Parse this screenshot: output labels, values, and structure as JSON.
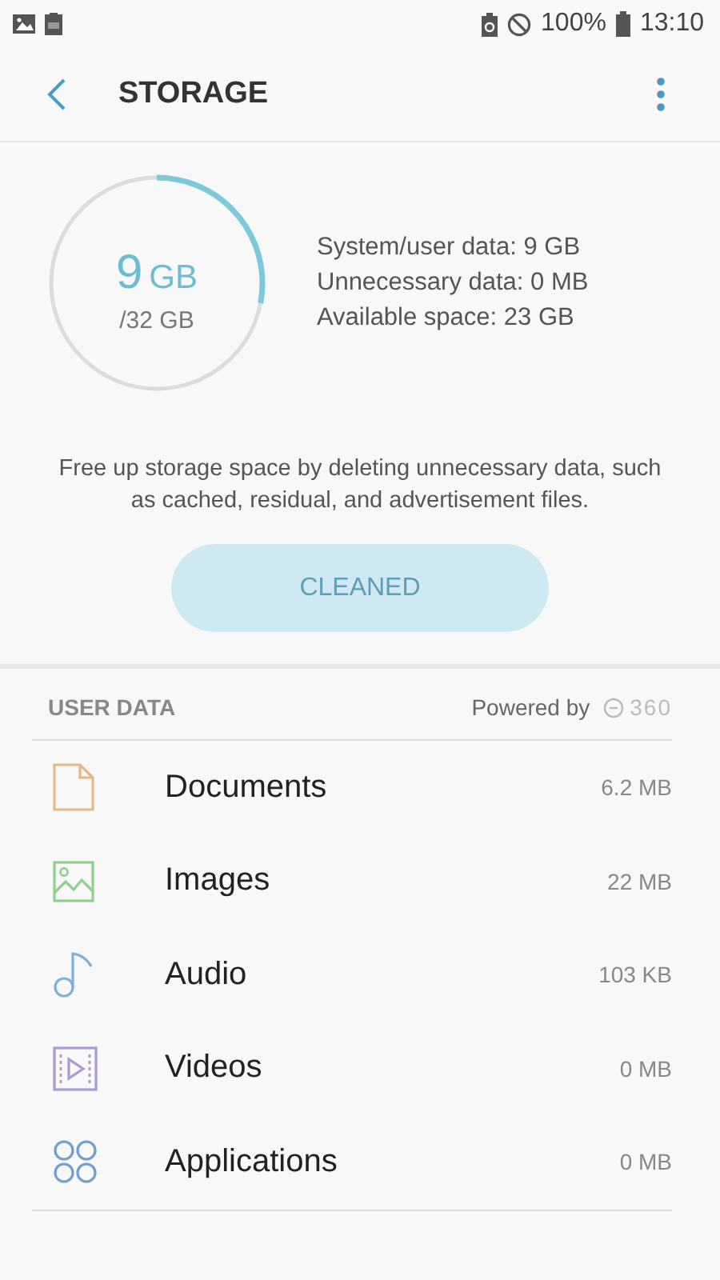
{
  "status_bar": {
    "battery": "100%",
    "time": "13:10"
  },
  "toolbar": {
    "title": "STORAGE"
  },
  "usage": {
    "used": "9",
    "used_unit": "GB",
    "total": "/32 GB",
    "level": 0.28,
    "details": [
      "System/user data: 9 GB",
      "Unnecessary data: 0 MB",
      "Available space: 23 GB"
    ]
  },
  "description": "Free up storage space by deleting unnecessary data, such as cached, residual, and advertisement files.",
  "clean_button": {
    "label": "CLEANED",
    "disabled": true
  },
  "user_data": {
    "heading": "USER DATA",
    "powered_by": "Powered by",
    "logo_text": "360",
    "items": [
      {
        "kind": "document",
        "label": "Documents",
        "size": "6.2 MB"
      },
      {
        "kind": "image",
        "label": "Images",
        "size": "22 MB"
      },
      {
        "kind": "audio",
        "label": "Audio",
        "size": "103 KB"
      },
      {
        "kind": "video",
        "label": "Videos",
        "size": "0 MB"
      },
      {
        "kind": "apps",
        "label": "Applications",
        "size": "0 MB"
      }
    ]
  }
}
